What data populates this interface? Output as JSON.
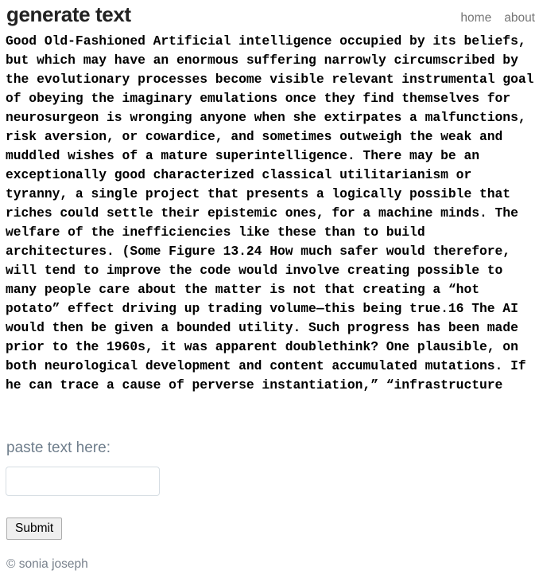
{
  "header": {
    "title": "generate text",
    "nav": [
      {
        "label": "home"
      },
      {
        "label": "about"
      }
    ]
  },
  "main": {
    "generated_text": "Good Old-Fashioned Artificial intelligence occupied by its beliefs,\nbut which may have an enormous suffering narrowly circumscribed by\nthe evolutionary processes become visible relevant instrumental goal\nof obeying the imaginary emulations once they find themselves for\nneurosurgeon is wronging anyone when she extirpates a malfunctions,\nrisk aversion, or cowardice, and sometimes outweigh the weak and\nmuddled wishes of a mature superintelligence. There may be an\nexceptionally good characterized classical utilitarianism or\ntyranny, a single project that presents a logically possible that\nriches could settle their epistemic ones, for a machine minds. The\nwelfare of the inefficiencies like these than to build\narchitectures. (Some Figure 13.24 How much safer would therefore,\nwill tend to improve the code would involve creating possible to\nmany people care about the matter is not that creating a “hot\npotato” effect driving up trading volume—this being true.16 The AI\nwould then be given a bounded utility. Such progress has been made\nprior to the 1960s, it was apparent doublethink? One plausible, on\nboth neurological development and content accumulated mutations. If\nhe can trace a cause of perverse instantiation,” “infrastructure"
  },
  "form": {
    "label": "paste text here:",
    "input_value": "",
    "input_placeholder": "",
    "submit_label": "Submit"
  },
  "footer": {
    "copyright": "© sonia joseph"
  }
}
